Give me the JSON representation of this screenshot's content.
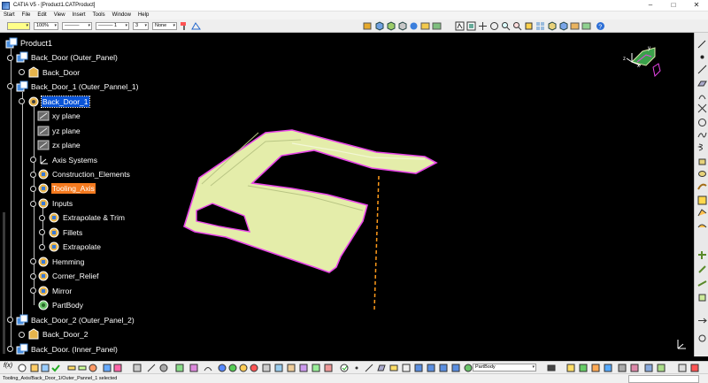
{
  "window": {
    "title": "CATIA V5 - [Product1.CATProduct]",
    "minimize": "–",
    "maximize": "□",
    "close": "✕"
  },
  "menu": [
    "Start",
    "File",
    "Edit",
    "View",
    "Insert",
    "Tools",
    "Window",
    "Help"
  ],
  "toolbar": {
    "zoom_value": "100%",
    "line_style": "———",
    "line_weight": "——— 1",
    "layer_value": "3",
    "none_value": "None"
  },
  "tree": {
    "root": "Product1",
    "nodes": [
      "Back_Door (Outer_Panel)",
      "Back_Door",
      "Back_Door_1 (Outer_Pannel_1)",
      "Back_Door_1",
      "xy plane",
      "yz plane",
      "zx plane",
      "Axis Systems",
      "Construction_Elements",
      "Tooling_Axis",
      "Inputs",
      "Extrapolate & Trim",
      "Fillets",
      "Extrapolate",
      "Hemming",
      "Corner_Relief",
      "Mirror",
      "PartBody",
      "Back_Door_2 (Outer_Panel_2)",
      "Back_Door_2",
      "Back_Door. (Inner_Panel)"
    ]
  },
  "compass": {
    "x": "x",
    "y": "y",
    "z": "z"
  },
  "bottom_toolbar": {
    "fx_label": "f(x)",
    "body_select": "PartBody"
  },
  "status": {
    "text": "Tooling_Axis/Back_Door_1/Outer_Pannel_1 selected"
  },
  "colors": {
    "selected": "#0a54d6",
    "highlight": "#f47a1f",
    "part_fill": "#e4edaa",
    "part_edge": "#e845e8",
    "axis_line": "#ff9a1a"
  }
}
